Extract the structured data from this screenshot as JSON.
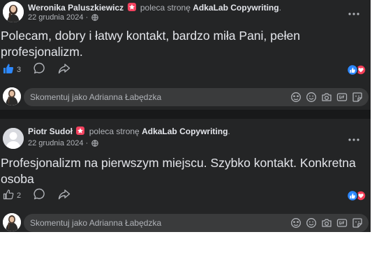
{
  "posts": [
    {
      "author": "Weronika Paluszkiewicz",
      "action": "poleca stronę",
      "page": "AdkaLab Copywriting",
      "punct": ".",
      "date": "22 grudnia 2024",
      "sep": "·",
      "text": "Polecam, dobry i łatwy kontakt, bardzo miła Pani, pełen profesjonalizm.",
      "likes": "3",
      "liked": true
    },
    {
      "author": "Piotr Sudoł",
      "action": "poleca stronę",
      "page": "AdkaLab Copywriting",
      "punct": ".",
      "date": "22 grudnia 2024",
      "sep": "·",
      "text": "Profesjonalizm na pierwszym miejscu. Szybko kontakt. Konkretna osoba",
      "likes": "2",
      "liked": false
    }
  ],
  "comment": {
    "placeholder": "Skomentuj jako Adrianna Łabędzka"
  },
  "colors": {
    "background": "#242526",
    "input": "#3a3b3c",
    "accent": "#2d88ff",
    "recommend": "#f3425f",
    "love": "#f33e58"
  },
  "icons": [
    "more-icon",
    "globe-icon",
    "like-icon",
    "comment-icon",
    "share-icon",
    "avatar-icon",
    "gif-icon",
    "emoji-icon",
    "camera-icon",
    "sticker-icon"
  ]
}
